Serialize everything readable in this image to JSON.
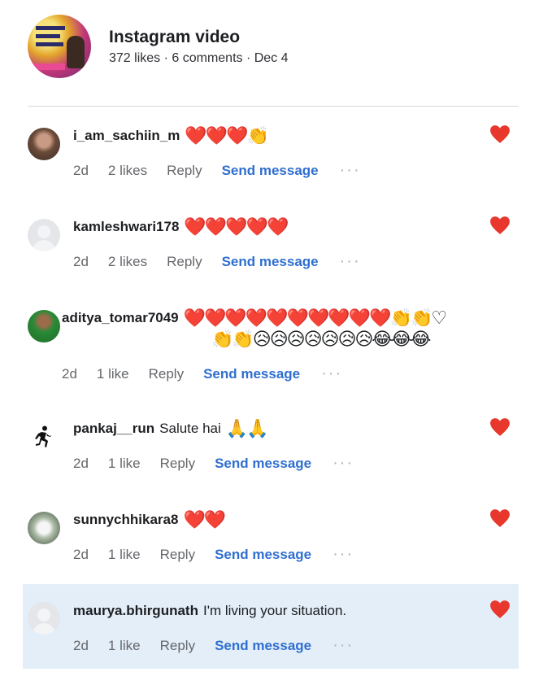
{
  "post": {
    "title": "Instagram video",
    "meta": "372 likes · 6 comments · Dec 4"
  },
  "colors": {
    "heart": "#e8372c",
    "link": "#2f6fcf",
    "muted": "#65676b",
    "highlight": "#e4eef8"
  },
  "actions": {
    "reply_label": "Reply",
    "send_label": "Send message",
    "more_label": "···"
  },
  "comments": [
    {
      "username": "i_am_sachiin_m",
      "text": "",
      "emojis": "❤️❤️❤️👏",
      "emojis_line2": "",
      "time": "2d",
      "likes": "2 likes"
    },
    {
      "username": "kamleshwari178",
      "text": "",
      "emojis": "❤️❤️❤️❤️❤️",
      "emojis_line2": "",
      "time": "2d",
      "likes": "2 likes"
    },
    {
      "username": "aditya_tomar7049",
      "text": "",
      "emojis": "❤️❤️❤️❤️❤️❤️❤️❤️❤️❤️👏👏♡",
      "emojis_line2": "👏👏😥😥😥😥😥😥😥😂😂😂",
      "time": "2d",
      "likes": "1 like"
    },
    {
      "username": "pankaj__run",
      "text": "Salute hai",
      "emojis": "🙏🙏",
      "emojis_line2": "",
      "time": "2d",
      "likes": "1 like"
    },
    {
      "username": "sunnychhikara8",
      "text": "",
      "emojis": "❤️❤️",
      "emojis_line2": "",
      "time": "2d",
      "likes": "1 like"
    },
    {
      "username": "maurya.bhirgunath",
      "text": "I'm living your situation.",
      "emojis": "",
      "emojis_line2": "",
      "time": "2d",
      "likes": "1 like"
    }
  ]
}
